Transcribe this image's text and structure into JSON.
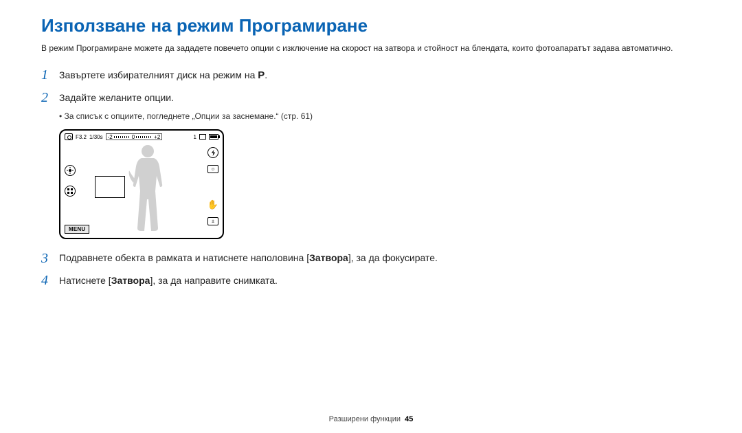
{
  "title": "Използване на режим Програмиране",
  "intro": "В режим Програмиране можете да зададете повечето опции с изключение на скорост на затвора и стойност на блендата, които фотоапаратът задава автоматично.",
  "steps": {
    "s1": {
      "num": "1",
      "text_pre": "Завъртете избирателният диск на режим на ",
      "mode_icon": "P",
      "text_post": "."
    },
    "s2": {
      "num": "2",
      "text": "Задайте желаните опции.",
      "bullet": "За списък с опциите, погледнете „Опции за заснемане.“ (стр. 61)"
    },
    "s3": {
      "num": "3",
      "text_pre": "Подравнете обекта в рамката и натиснете наполовина [",
      "bold": "Затвора",
      "text_post": "], за да фокусирате."
    },
    "s4": {
      "num": "4",
      "text_pre": "Натиснете [",
      "bold": "Затвора",
      "text_post": "], за да направите снимката."
    }
  },
  "screen": {
    "aperture": "F3.2",
    "shutter": "1/30s",
    "ev_minus": "-2",
    "ev_zero": "0",
    "ev_plus": "+2",
    "count": "1",
    "menu": "MENU",
    "flash_icon": "⚡",
    "face_label": "☺",
    "hand_icon": "✋",
    "plusminus": "±"
  },
  "footer": {
    "section": "Разширени функции",
    "page": "45"
  }
}
